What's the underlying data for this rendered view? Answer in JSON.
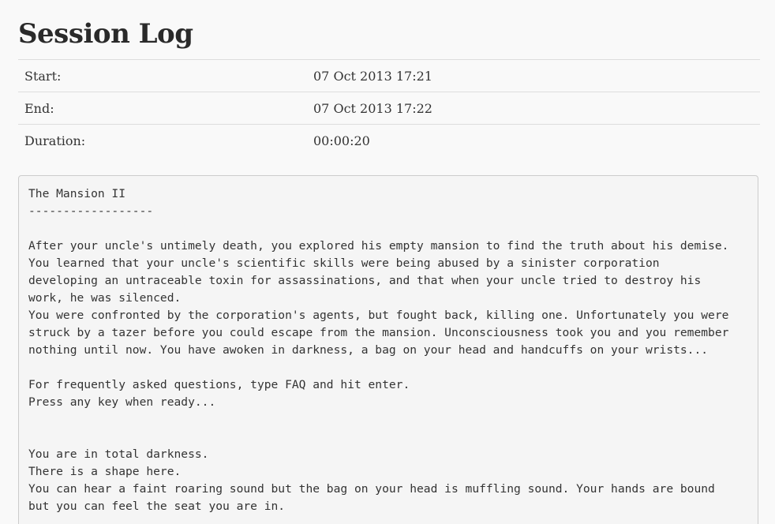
{
  "page": {
    "title": "Session Log"
  },
  "session": {
    "rows": [
      {
        "label": "Start:",
        "value": "07 Oct 2013 17:21"
      },
      {
        "label": "End:",
        "value": "07 Oct 2013 17:22"
      },
      {
        "label": "Duration:",
        "value": "00:00:20"
      }
    ]
  },
  "log": {
    "lines": [
      "The Mansion II",
      "------------------",
      "",
      "After your uncle's untimely death, you explored his empty mansion to find the truth about his demise.",
      "You learned that your uncle's scientific skills were being abused by a sinister corporation",
      "developing an untraceable toxin for assassinations, and that when your uncle tried to destroy his",
      "work, he was silenced.",
      "You were confronted by the corporation's agents, but fought back, killing one. Unfortunately you were",
      "struck by a tazer before you could escape from the mansion. Unconsciousness took you and you remember",
      "nothing until now. You have awoken in darkness, a bag on your head and handcuffs on your wrists...",
      "",
      "For frequently asked questions, type FAQ and hit enter.",
      "Press any key when ready...",
      "",
      "",
      "You are in total darkness.",
      "There is a shape here.",
      "You can hear a faint roaring sound but the bag on your head is muffling sound. Your hands are bound",
      "but you can feel the seat you are in."
    ]
  }
}
